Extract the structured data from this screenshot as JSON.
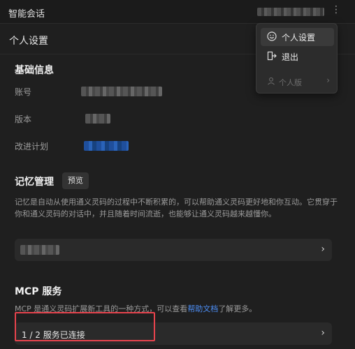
{
  "topbar": {
    "title": "智能会话"
  },
  "header": {
    "title": "个人设置"
  },
  "basic": {
    "title": "基础信息",
    "account_label": "账号",
    "version_label": "版本",
    "improve_label": "改进计划"
  },
  "memory": {
    "title": "记忆管理",
    "badge": "预览",
    "desc": "记忆是自动从使用通义灵码的过程中不断积累的，可以帮助通义灵码更好地和你互动。它贯穿于你和通义灵码的对话中，并且随着时间流逝，也能够让通义灵码越来越懂你。"
  },
  "mcp": {
    "title": "MCP 服务",
    "desc_pre": "MCP 是通义灵码扩展新工具的一种方式，可以查看",
    "desc_link": "帮助文档",
    "desc_post": "了解更多。",
    "status": "1 / 2 服务已连接"
  },
  "menu": {
    "items": [
      {
        "label": "个人设置",
        "icon": "smile-icon"
      },
      {
        "label": "退出",
        "icon": "logout-icon"
      }
    ],
    "plan": {
      "label": "个人版",
      "icon": "user-icon"
    }
  },
  "colors": {
    "accent_link": "#4d8ff7",
    "highlight": "#e8434d",
    "background": "#1f1f1f"
  }
}
